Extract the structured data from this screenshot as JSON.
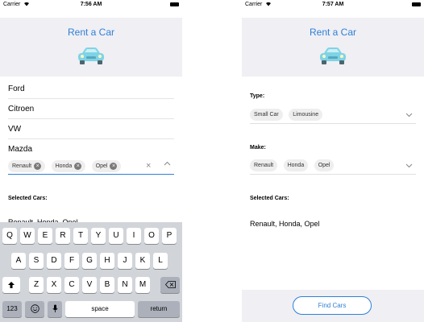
{
  "left": {
    "status": {
      "carrier": "Carrier",
      "time": "7:56 AM"
    },
    "header_title": "Rent a Car",
    "dropdown_items": [
      "Ford",
      "Citroen",
      "VW",
      "Mazda"
    ],
    "chips": [
      "Renault",
      "Honda",
      "Opel"
    ],
    "selected_label": "Selected Cars:",
    "selected_value": "Renault, Honda, Opel",
    "keyboard": {
      "row1": [
        "Q",
        "W",
        "E",
        "R",
        "T",
        "Y",
        "U",
        "I",
        "O",
        "P"
      ],
      "row2": [
        "A",
        "S",
        "D",
        "F",
        "G",
        "H",
        "J",
        "K",
        "L"
      ],
      "row3": [
        "Z",
        "X",
        "C",
        "V",
        "B",
        "N",
        "M"
      ],
      "numbers": "123",
      "space": "space",
      "return": "return"
    }
  },
  "right": {
    "status": {
      "carrier": "Carrier",
      "time": "7:57 AM"
    },
    "header_title": "Rent a Car",
    "type_label": "Type:",
    "type_chips": [
      "Small Car",
      "Limousine"
    ],
    "make_label": "Make:",
    "make_chips": [
      "Renault",
      "Honda",
      "Opel"
    ],
    "selected_label": "Selected Cars:",
    "selected_value": "Renault, Honda, Opel",
    "find_button": "Find Cars"
  },
  "colors": {
    "accent": "#2f7fd6",
    "header_bg": "#efeff4",
    "car": "#7fd3e6"
  },
  "icons": [
    "wifi-icon",
    "battery-icon",
    "car-icon",
    "clear-icon",
    "chevron-up-icon",
    "chevron-down-icon",
    "shift-icon",
    "backspace-icon",
    "emoji-icon",
    "microphone-icon"
  ]
}
